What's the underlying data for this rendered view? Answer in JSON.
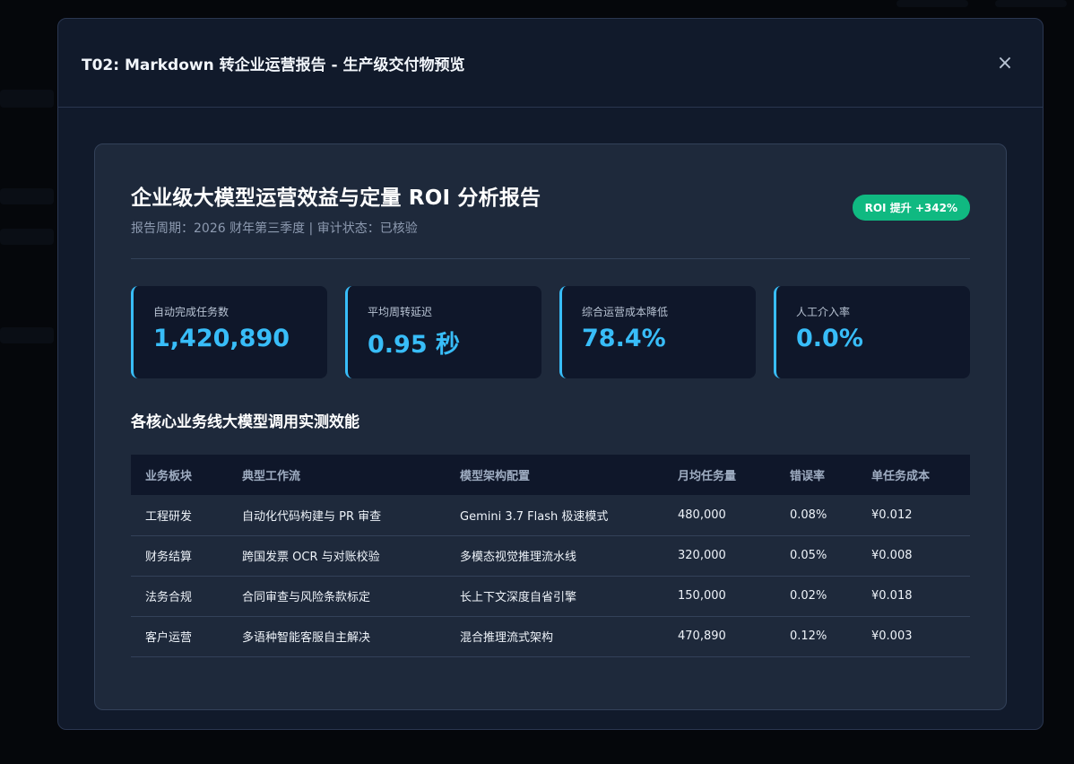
{
  "modal": {
    "title": "T02: Markdown 转企业运营报告 - 生产级交付物预览",
    "close_label": "×"
  },
  "report": {
    "title": "企业级大模型运营效益与定量 ROI 分析报告",
    "subtitle": "报告周期：2026 财年第三季度 | 审计状态：已核验",
    "badge": "ROI 提升 +342%"
  },
  "kpis": [
    {
      "label": "自动完成任务数",
      "value": "1,420,890"
    },
    {
      "label": "平均周转延迟",
      "value": "0.95 秒"
    },
    {
      "label": "综合运营成本降低",
      "value": "78.4%"
    },
    {
      "label": "人工介入率",
      "value": "0.0%"
    }
  ],
  "table": {
    "section_title": "各核心业务线大模型调用实测效能",
    "headers": [
      "业务板块",
      "典型工作流",
      "模型架构配置",
      "月均任务量",
      "错误率",
      "单任务成本"
    ],
    "rows": [
      [
        "工程研发",
        "自动化代码构建与 PR 审查",
        "Gemini 3.7 Flash 极速模式",
        "480,000",
        "0.08%",
        "¥0.012"
      ],
      [
        "财务结算",
        "跨国发票 OCR 与对账校验",
        "多模态视觉推理流水线",
        "320,000",
        "0.05%",
        "¥0.008"
      ],
      [
        "法务合规",
        "合同审查与风险条款标定",
        "长上下文深度自省引擎",
        "150,000",
        "0.02%",
        "¥0.018"
      ],
      [
        "客户运营",
        "多语种智能客服自主解决",
        "混合推理流式架构",
        "470,890",
        "0.12%",
        "¥0.003"
      ]
    ]
  },
  "colors": {
    "accent": "#38bdf8",
    "badge": "#10b981",
    "card": "#0f172a",
    "panel": "#1e293b"
  }
}
